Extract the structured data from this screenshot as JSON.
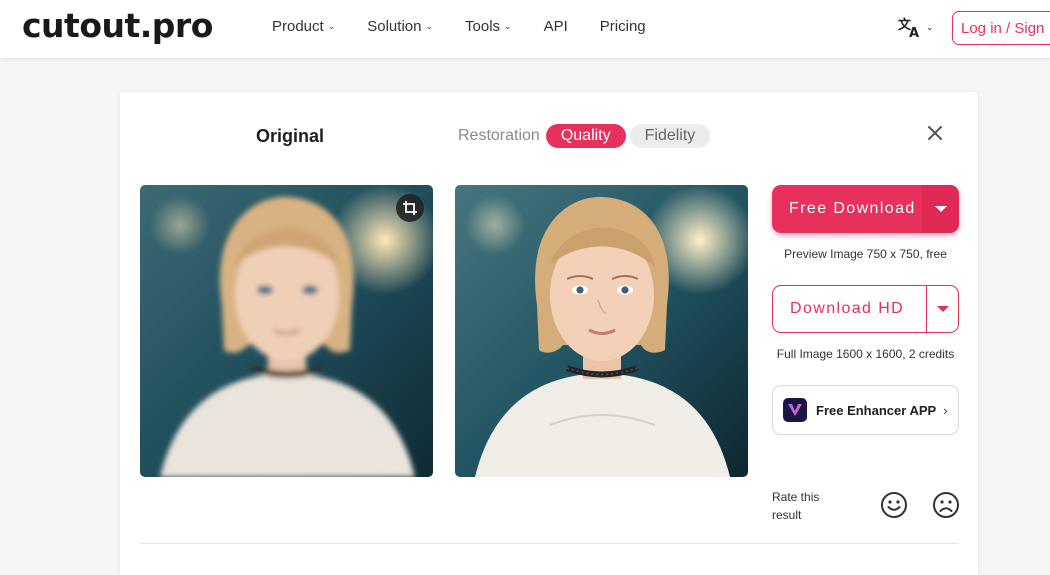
{
  "header": {
    "logo": "cutout.pro",
    "nav": [
      {
        "label": "Product",
        "has_dropdown": true
      },
      {
        "label": "Solution",
        "has_dropdown": true
      },
      {
        "label": "Tools",
        "has_dropdown": true
      },
      {
        "label": "API",
        "has_dropdown": false
      },
      {
        "label": "Pricing",
        "has_dropdown": false
      }
    ],
    "language_icon": "translate-icon",
    "login_label": "Log in / Sign"
  },
  "card": {
    "title": "Original",
    "tabs": [
      {
        "label": "Restoration",
        "state": "plain"
      },
      {
        "label": "Quality",
        "state": "active"
      },
      {
        "label": "Fidelity",
        "state": "inactive"
      }
    ],
    "free_download_label": "Free Download",
    "preview_note": "Preview Image 750 x 750, free",
    "download_hd_label": "Download HD",
    "hd_note": "Full Image 1600 x 1600, 2 credits",
    "app_label": "Free Enhancer APP",
    "rate_label": "Rate this result"
  },
  "colors": {
    "accent": "#e8305c",
    "app_icon_bg": "#1c1444"
  }
}
